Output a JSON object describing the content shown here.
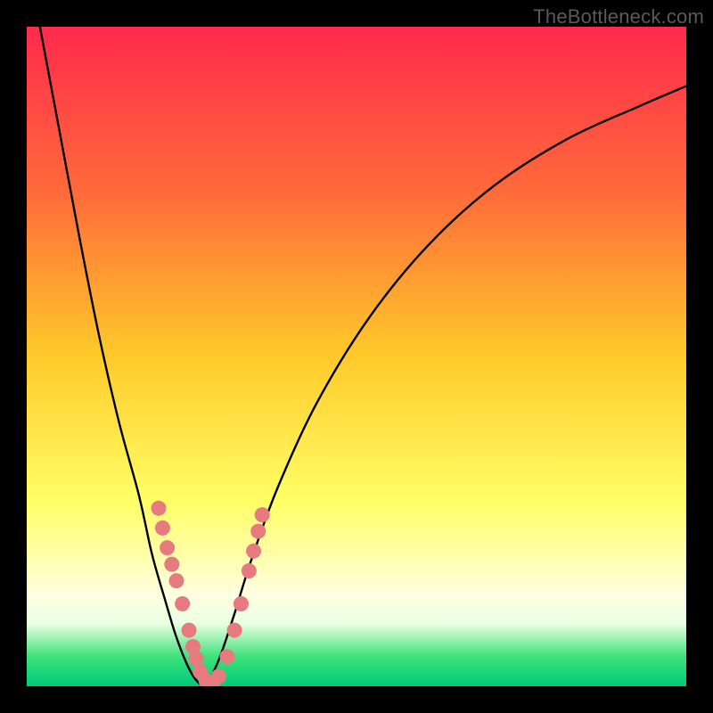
{
  "watermark": "TheBottleneck.com",
  "chart_data": {
    "type": "line",
    "title": "",
    "xlabel": "",
    "ylabel": "",
    "xlim": [
      0,
      100
    ],
    "ylim": [
      0,
      100
    ],
    "grid": false,
    "legend": false,
    "gradient_stops": [
      {
        "offset": 0.0,
        "color": "#ff2a4d"
      },
      {
        "offset": 0.25,
        "color": "#ff6a3a"
      },
      {
        "offset": 0.5,
        "color": "#ffca2a"
      },
      {
        "offset": 0.72,
        "color": "#ffff66"
      },
      {
        "offset": 0.8,
        "color": "#ffffa8"
      },
      {
        "offset": 0.86,
        "color": "#ffffe0"
      },
      {
        "offset": 0.905,
        "color": "#eaffe2"
      },
      {
        "offset": 0.955,
        "color": "#3fe27a"
      },
      {
        "offset": 1.0,
        "color": "#00c97a"
      }
    ],
    "series": [
      {
        "name": "bottleneck-curve-left",
        "x": [
          2,
          5,
          8,
          11,
          14,
          17,
          19,
          21,
          22.5,
          24,
          25.2,
          26.2,
          27
        ],
        "y": [
          100,
          84,
          68,
          53,
          40,
          29,
          20,
          13,
          8,
          4,
          1.6,
          0.4,
          0
        ]
      },
      {
        "name": "bottleneck-curve-right",
        "x": [
          27,
          28,
          29.5,
          31.5,
          34,
          38,
          44,
          52,
          61,
          71,
          82,
          93,
          100
        ],
        "y": [
          0,
          1.5,
          5,
          11,
          19,
          30,
          43,
          56,
          67,
          76,
          83,
          88,
          91
        ]
      }
    ],
    "markers": {
      "name": "highlight-dots",
      "color": "#e77a7f",
      "radius": 8.5,
      "points": [
        {
          "x": 20.0,
          "y": 27.0
        },
        {
          "x": 20.6,
          "y": 24.0
        },
        {
          "x": 21.3,
          "y": 21.0
        },
        {
          "x": 22.0,
          "y": 18.5
        },
        {
          "x": 22.7,
          "y": 16.0
        },
        {
          "x": 23.6,
          "y": 12.5
        },
        {
          "x": 24.6,
          "y": 8.5
        },
        {
          "x": 25.2,
          "y": 6.0
        },
        {
          "x": 25.7,
          "y": 4.2
        },
        {
          "x": 26.3,
          "y": 2.2
        },
        {
          "x": 27.2,
          "y": 0.8
        },
        {
          "x": 28.2,
          "y": 0.6
        },
        {
          "x": 29.1,
          "y": 1.5
        },
        {
          "x": 30.4,
          "y": 4.5
        },
        {
          "x": 31.5,
          "y": 8.5
        },
        {
          "x": 32.5,
          "y": 12.5
        },
        {
          "x": 33.7,
          "y": 17.5
        },
        {
          "x": 34.4,
          "y": 20.5
        },
        {
          "x": 35.1,
          "y": 23.5
        },
        {
          "x": 35.7,
          "y": 26.0
        }
      ]
    }
  }
}
